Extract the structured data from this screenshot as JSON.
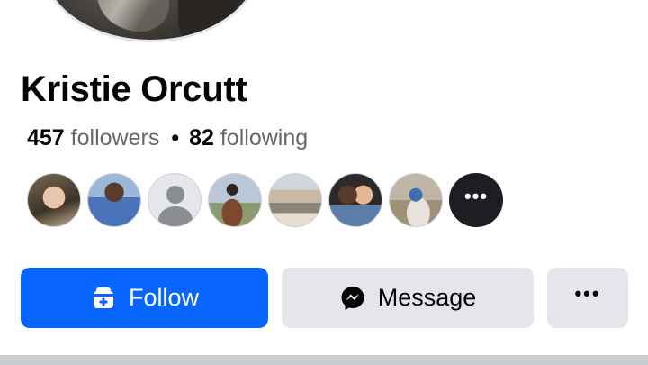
{
  "profile": {
    "name": "Kristie Orcutt",
    "followers_count": "457",
    "followers_label": "followers",
    "separator": "•",
    "following_count": "82",
    "following_label": "following"
  },
  "friends": {
    "more_label": "•••"
  },
  "actions": {
    "follow_label": "Follow",
    "message_label": "Message",
    "more_label": "•••"
  },
  "colors": {
    "accent": "#0866ff",
    "secondary_button": "#e4e6eb",
    "text_primary": "#050505",
    "text_secondary": "#65676b"
  },
  "icons": {
    "follow": "add-friend-icon",
    "message": "messenger-icon",
    "more": "more-options-icon"
  }
}
